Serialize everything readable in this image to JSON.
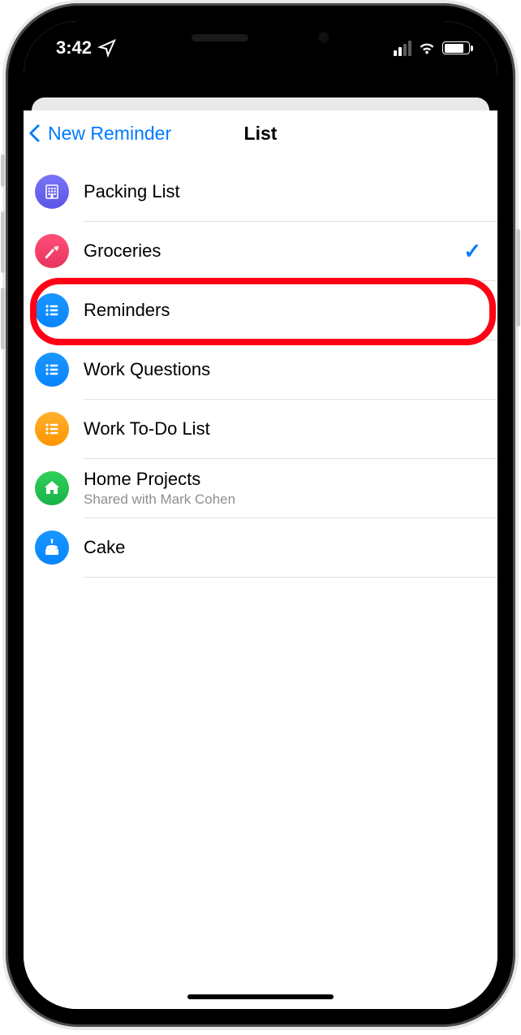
{
  "status": {
    "time": "3:42",
    "location_glyph": "➤"
  },
  "nav": {
    "back_label": "New Reminder",
    "title": "List"
  },
  "lists": [
    {
      "id": "packing",
      "label": "Packing List",
      "icon": "building",
      "color": "purple",
      "selected": false
    },
    {
      "id": "groceries",
      "label": "Groceries",
      "icon": "carrot",
      "color": "red",
      "selected": true
    },
    {
      "id": "reminders",
      "label": "Reminders",
      "icon": "bullets",
      "color": "blue",
      "selected": false,
      "highlighted": true
    },
    {
      "id": "workq",
      "label": "Work Questions",
      "icon": "bullets",
      "color": "blue",
      "selected": false
    },
    {
      "id": "worktodo",
      "label": "Work To-Do List",
      "icon": "bullets",
      "color": "orange",
      "selected": false
    },
    {
      "id": "home",
      "label": "Home Projects",
      "icon": "house",
      "color": "green",
      "selected": false,
      "subtitle": "Shared with Mark Cohen"
    },
    {
      "id": "cake",
      "label": "Cake",
      "icon": "cake",
      "color": "blue",
      "selected": false
    }
  ],
  "highlight_index": 2
}
